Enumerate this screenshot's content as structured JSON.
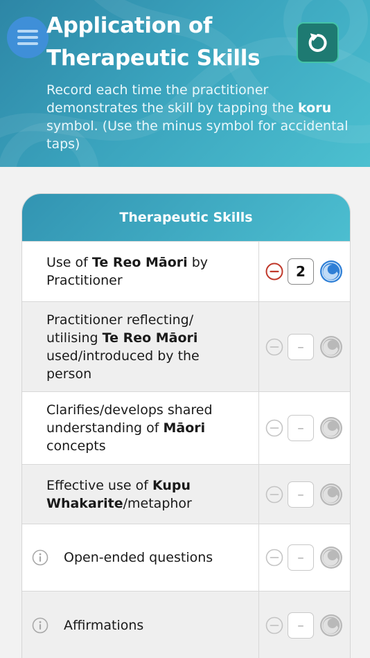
{
  "header": {
    "title": "Application of Therapeutic Skills",
    "subtitle_part1": "Record each time the practitioner demonstrates the skill by tapping the ",
    "subtitle_bold": "koru",
    "subtitle_part2": " symbol. (Use the minus symbol for accidental taps)"
  },
  "table": {
    "heading": "Therapeutic Skills",
    "rows": [
      {
        "pre": "Use of ",
        "bold": "Te Reo Māori",
        "post": " by Practitioner",
        "count": "2"
      },
      {
        "pre": "Practitioner reflecting/ utilising ",
        "bold": "Te Reo Māori",
        "post": " used/introduced by the person",
        "count": "–"
      },
      {
        "pre": "Clarifies/develops shared understanding of ",
        "bold": "Māori",
        "post": " concepts",
        "count": "–"
      },
      {
        "pre": "Effective use of ",
        "bold": "Kupu Whakarite",
        "post": "/metaphor",
        "count": "–"
      },
      {
        "pre": "Open-ended questions",
        "bold": "",
        "post": "",
        "count": "–"
      },
      {
        "pre": "Affirmations",
        "bold": "",
        "post": "",
        "count": "–"
      }
    ]
  },
  "colors": {
    "accent": "#3aa3bd",
    "minus_active": "#c0392b",
    "koru_active": "#2f7fd6",
    "reset_bg": "#1e7a72"
  },
  "icons": {
    "menu": "hamburger-icon",
    "reset": "reset-icon",
    "minus": "minus-circle-icon",
    "koru": "koru-icon",
    "info": "info-icon"
  }
}
